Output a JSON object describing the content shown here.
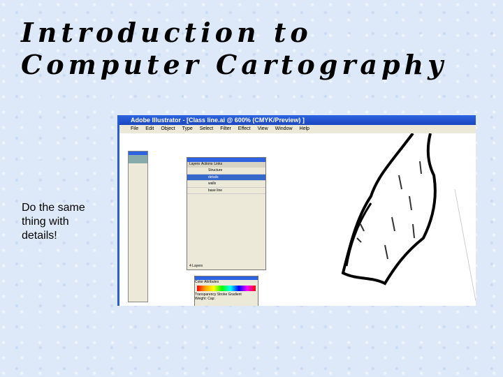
{
  "slide": {
    "title": "Introduction to Computer Cartography",
    "body": "Do the same thing with details!"
  },
  "app": {
    "title": "Adobe Illustrator - [Class line.ai @ 600% (CMYK/Preview) ]",
    "menu": [
      "File",
      "Edit",
      "Object",
      "Type",
      "Select",
      "Filter",
      "Effect",
      "View",
      "Window",
      "Help"
    ],
    "layers_panel": {
      "tabs": [
        "Layers",
        "Actions",
        "Links"
      ],
      "layers": [
        "Structure",
        "details",
        "walls",
        "base line"
      ],
      "selected": "details",
      "footer": "4 Layers"
    },
    "color_panel": {
      "tabs": [
        "Color",
        "Attributes"
      ],
      "stroke_tabs": [
        "Transparency",
        "Stroke",
        "Gradient"
      ],
      "weight_label": "Weight:",
      "cap_label": "Cap:"
    }
  }
}
